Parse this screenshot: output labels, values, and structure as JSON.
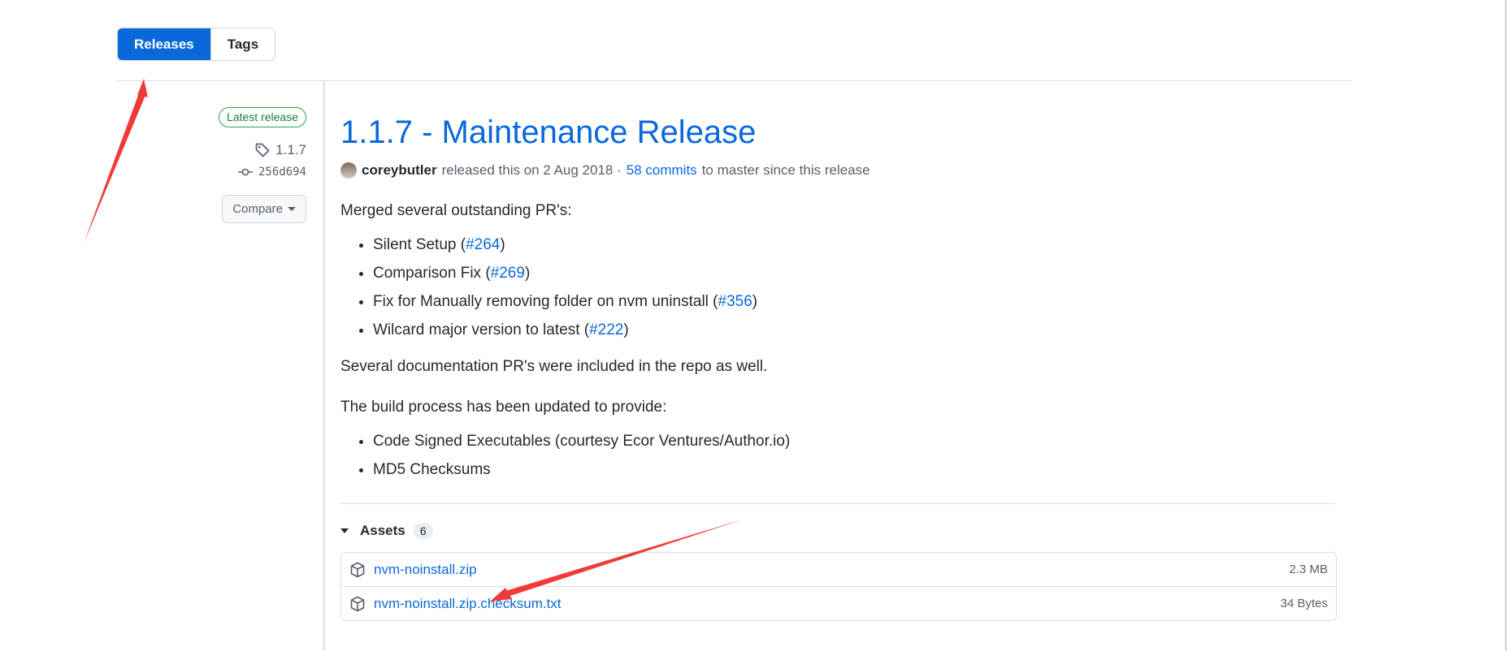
{
  "subnav": {
    "releases_label": "Releases",
    "tags_label": "Tags"
  },
  "release_meta": {
    "latest_badge": "Latest release",
    "tag": "1.1.7",
    "commit": "256d694",
    "compare_label": "Compare"
  },
  "release": {
    "title": "1.1.7 - Maintenance Release",
    "author": "coreybutler",
    "released_text": "released this on 2 Aug 2018 ·",
    "commits_link": "58 commits",
    "commits_suffix": "to master since this release",
    "intro": "Merged several outstanding PR's:",
    "prs": [
      {
        "text": "Silent Setup (",
        "link": "#264",
        "close": ")"
      },
      {
        "text": "Comparison Fix (",
        "link": "#269",
        "close": ")"
      },
      {
        "text": "Fix for Manually removing folder on nvm uninstall (",
        "link": "#356",
        "close": ")"
      },
      {
        "text": "Wilcard major version to latest (",
        "link": "#222",
        "close": ")"
      }
    ],
    "docs_note": "Several documentation PR's were included in the repo as well.",
    "build_intro": "The build process has been updated to provide:",
    "build_items": [
      "Code Signed Executables (courtesy Ecor Ventures/Author.io)",
      "MD5 Checksums"
    ]
  },
  "assets": {
    "heading": "Assets",
    "count": "6",
    "items": [
      {
        "name": "nvm-noinstall.zip",
        "size": "2.3 MB",
        "icon": "package-icon"
      },
      {
        "name": "nvm-noinstall.zip.checksum.txt",
        "size": "34 Bytes",
        "icon": "package-icon"
      }
    ]
  },
  "annotation_color": "#f03a3a",
  "accent_color": "#0969da"
}
